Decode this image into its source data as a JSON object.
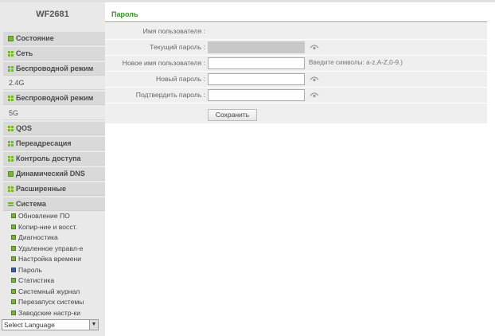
{
  "sidebar": {
    "model": "WF2681",
    "nav": [
      {
        "label": "Состояние",
        "icon": "status-square-icon"
      },
      {
        "label": "Сеть",
        "icon": "grid-icon"
      },
      {
        "label": "Беспроводной режим",
        "icon": "grid-icon"
      },
      {
        "label": "2.4G",
        "icon": ""
      },
      {
        "label": "Беспроводной режим",
        "icon": "grid-icon"
      },
      {
        "label": "5G",
        "icon": ""
      },
      {
        "label": "QOS",
        "icon": "grid-icon"
      },
      {
        "label": "Переадресация",
        "icon": "grid-icon"
      },
      {
        "label": "Контроль доступа",
        "icon": "grid-icon"
      },
      {
        "label": "Динамический DNS",
        "icon": "status-square-icon"
      },
      {
        "label": "Расширенные",
        "icon": "grid-icon"
      },
      {
        "label": "Система",
        "icon": "expanded-icon"
      }
    ],
    "submenu": [
      "Обновление ПО",
      "Копир-ние и восст.",
      "Диагностика",
      "Удаленное управл-е",
      "Настройка времени",
      "Пароль",
      "Статистика",
      "Системный журнал",
      "Перезапуск системы",
      "Заводские настр-ки"
    ],
    "active_submenu": "Пароль",
    "language_select": {
      "value": "Select Language"
    }
  },
  "main": {
    "tab_title": "Пароль",
    "form": {
      "username_label": "Имя пользователя :",
      "username_value": "",
      "current_password_label": "Текущий пароль :",
      "new_username_label": "Новое имя пользователя :",
      "new_username_hint": "Введите символы: a-z,A-Z,0-9.)",
      "new_password_label": "Новый пароль :",
      "confirm_password_label": "Подтвердить пароль :",
      "save_label": "Сохранить"
    }
  },
  "colors": {
    "accent_green": "#7ab336",
    "title_green": "#3c8a2a",
    "sidebar_bg": "#e9e9e9",
    "form_bg": "#efefef"
  }
}
